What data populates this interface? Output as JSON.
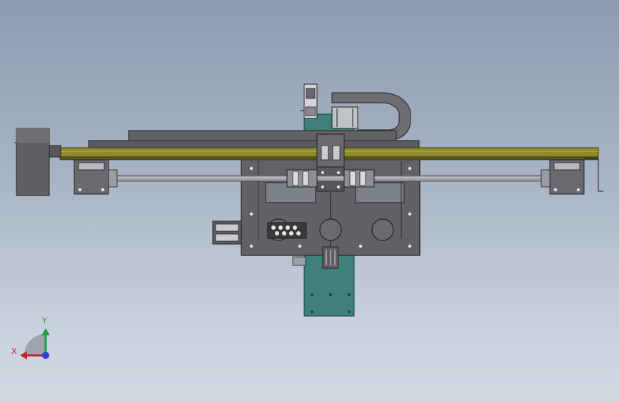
{
  "viewport": {
    "background_top": "#8d9bb0",
    "background_bottom": "#d2d9e3"
  },
  "colors": {
    "plate": "#616166",
    "plate_dark": "#3e3e42",
    "rail": "#8c8a2c",
    "rail_dark": "#5a591a",
    "teal": "#3f7f7c",
    "shaft": "#9c9ea4"
  },
  "triad": {
    "x_label": "X",
    "y_label": "Y",
    "x_color": "#c0262b",
    "y_color": "#1ea03a",
    "z_color": "#2a3fd6"
  }
}
